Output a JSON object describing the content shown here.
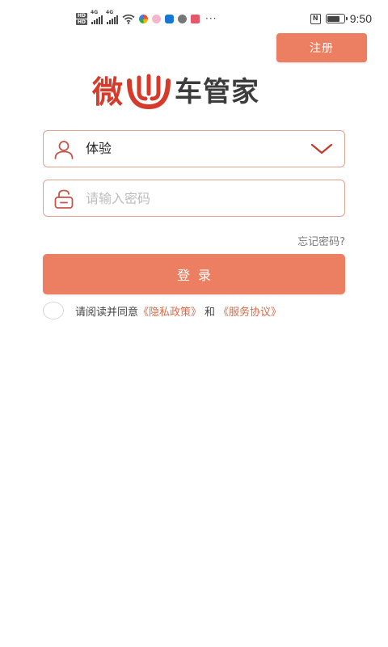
{
  "status_bar": {
    "hd1": "HD",
    "hd2": "HD",
    "net1": "4G",
    "net2": "4G",
    "more": "···",
    "nfc": "N",
    "time": "9:50"
  },
  "header": {
    "register_label": "注册"
  },
  "logo": {
    "wei": "微",
    "rest": "车管家",
    "red": "#d63a2a",
    "gray": "#3c3c3c"
  },
  "form": {
    "username_value": "体验",
    "password_placeholder": "请输入密码",
    "forgot_label": "忘记密码?",
    "login_label": "登录"
  },
  "agreement": {
    "prefix": "请阅读并同意",
    "privacy_link": "《隐私政策》",
    "and": "和",
    "service_link": "《服务协议》"
  },
  "colors": {
    "accent": "#ec7f62",
    "border": "#e0a28e",
    "link": "#d96a4a"
  }
}
